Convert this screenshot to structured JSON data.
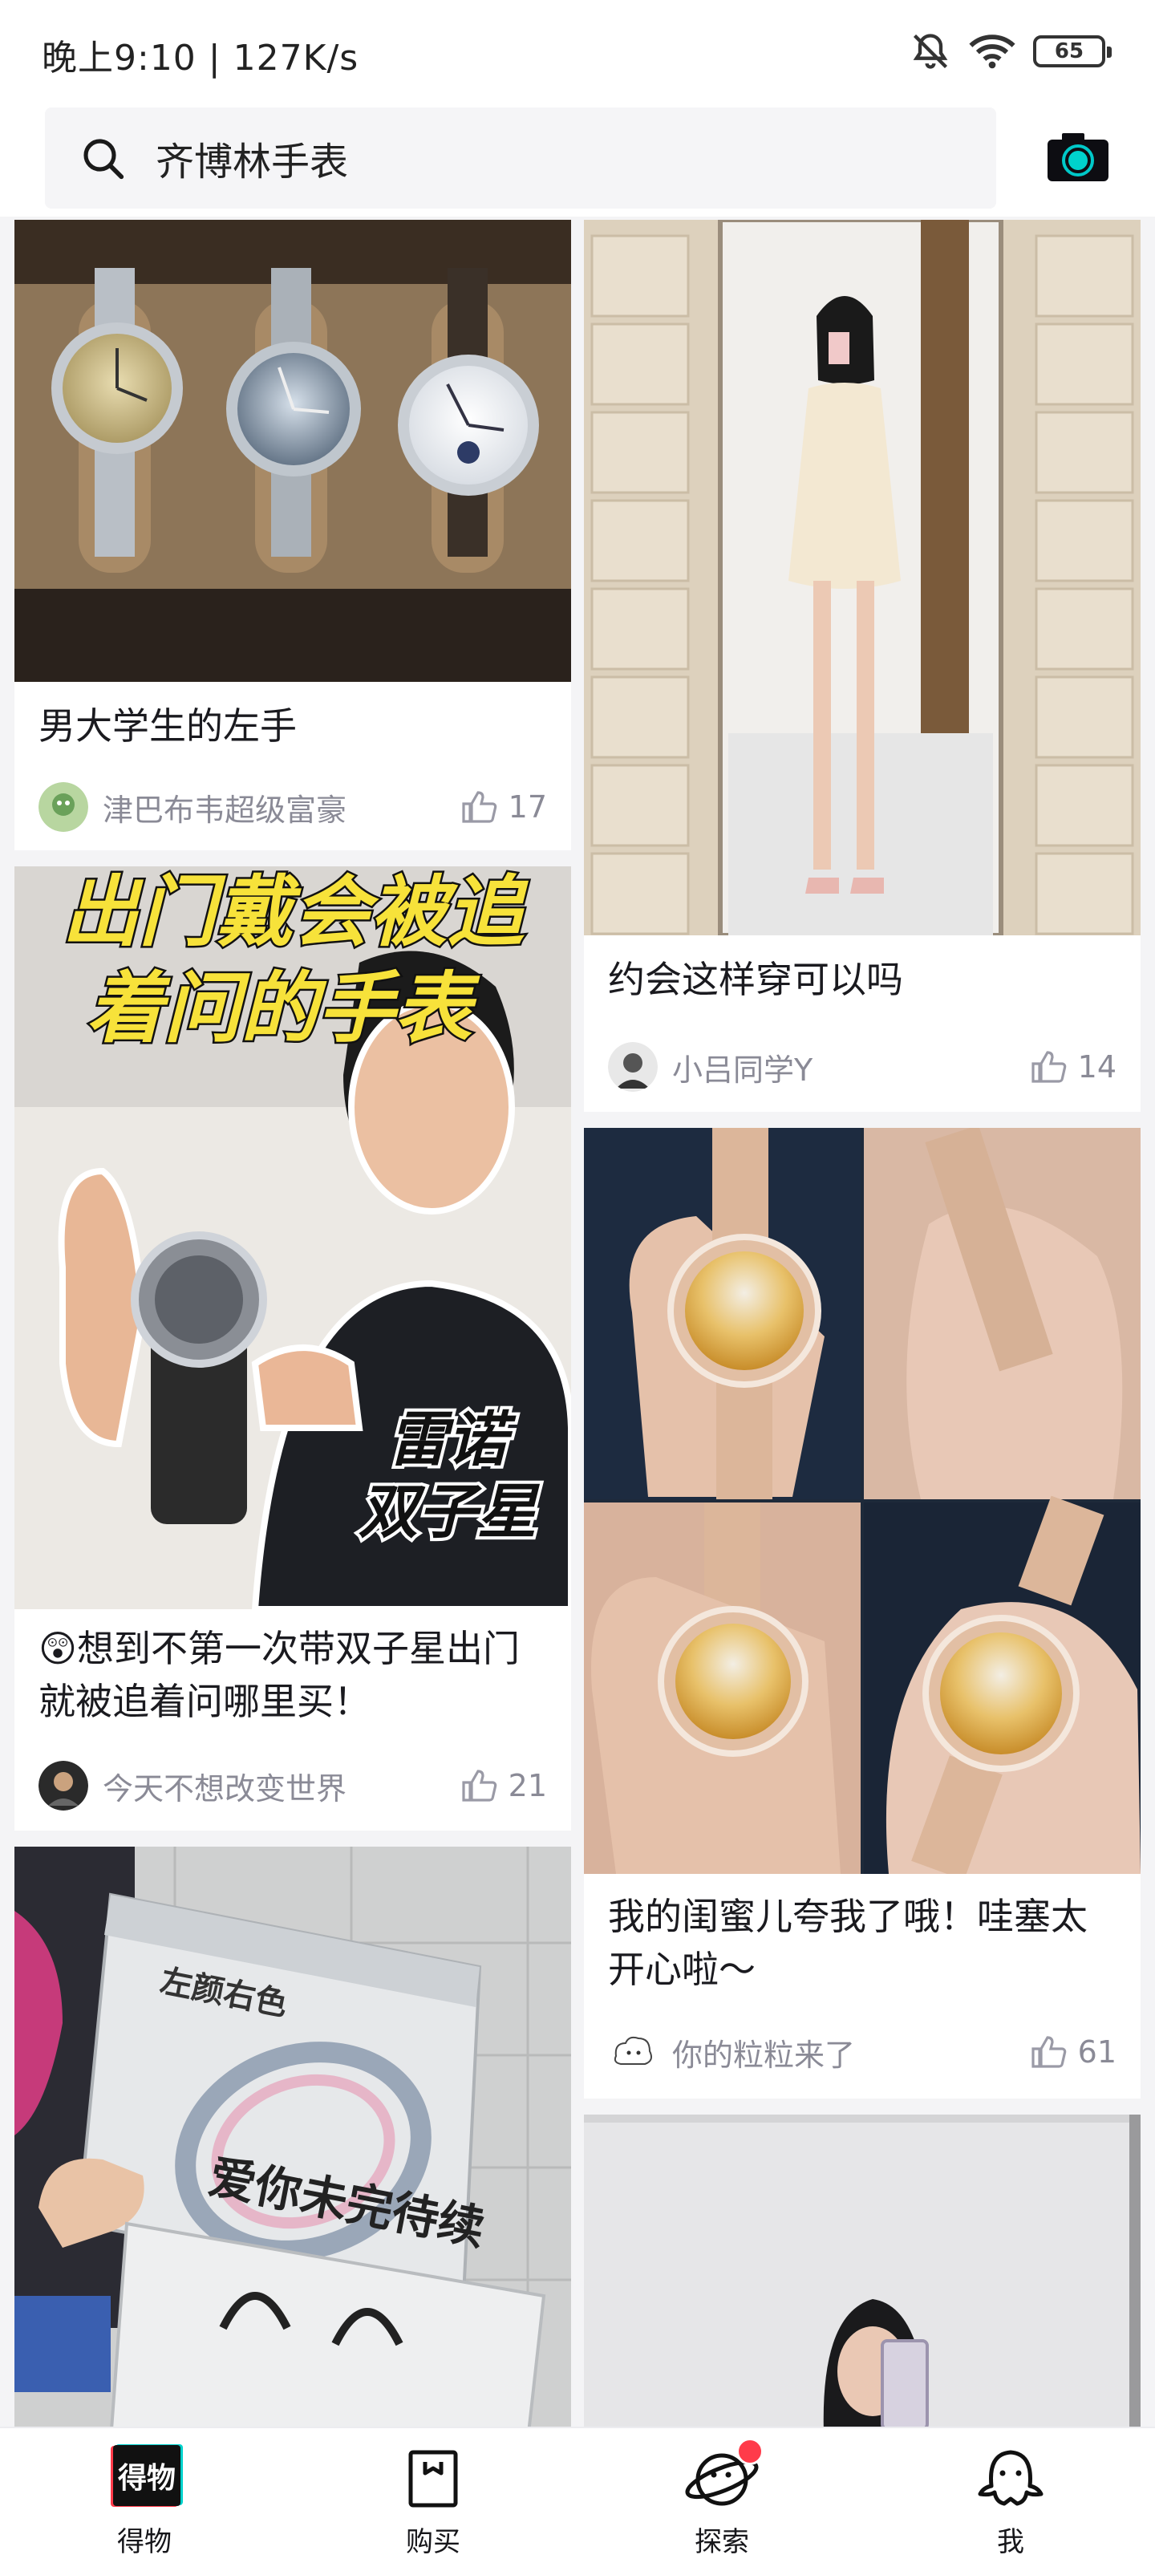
{
  "status_bar": {
    "time_speed": "晚上9:10 | 127K/s",
    "battery": "65",
    "icons": [
      "mute-bell-icon",
      "wifi-icon",
      "battery-icon"
    ]
  },
  "search": {
    "query": "齐博林手表",
    "camera_icon": "camera-icon"
  },
  "feed": {
    "left": [
      {
        "title": "男大学生的左手",
        "author": "津巴布韦超级富豪",
        "likes": "17"
      },
      {
        "title": "😲想到不第一次带双子星出门就被追着问哪里买！",
        "author": "今天不想改变世界",
        "likes": "21",
        "overlay_top": "出门戴会被追",
        "overlay_mid": "着问的手表",
        "overlay_b1": "雷诺",
        "overlay_b2": "双子星"
      },
      {
        "title": "",
        "author": "",
        "likes": "",
        "box_brand": "左颜右色",
        "box_text": "爱你未完待续"
      }
    ],
    "right": [
      {
        "title": "约会这样穿可以吗",
        "author": "小吕同学Y",
        "likes": "14"
      },
      {
        "title": "我的闺蜜儿夸我了哦！哇塞太开心啦～",
        "author": "你的粒粒来了",
        "likes": "61"
      },
      {
        "title": "",
        "author": "",
        "likes": ""
      }
    ]
  },
  "tabs": [
    {
      "label": "得物",
      "logo": "得物"
    },
    {
      "label": "购买"
    },
    {
      "label": "探索"
    },
    {
      "label": "我"
    }
  ],
  "colors": {
    "accent": "#00c9c9",
    "badge": "#ff3b4a",
    "meta_text": "#8a8a96"
  }
}
